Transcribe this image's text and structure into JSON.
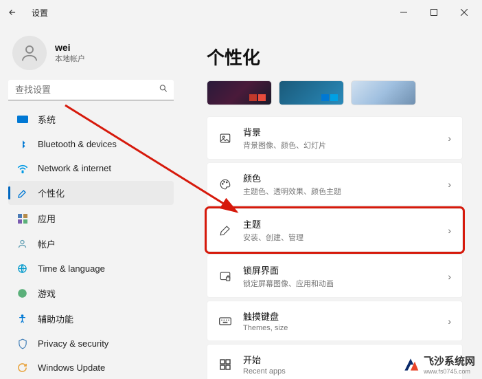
{
  "titlebar": {
    "title": "设置"
  },
  "user": {
    "name": "wei",
    "sub": "本地帐户"
  },
  "search": {
    "placeholder": "查找设置"
  },
  "nav": {
    "system": "系统",
    "bluetooth": "Bluetooth & devices",
    "network": "Network & internet",
    "personalization": "个性化",
    "apps": "应用",
    "accounts": "帐户",
    "time": "Time & language",
    "gaming": "游戏",
    "accessibility": "辅助功能",
    "privacy": "Privacy & security",
    "update": "Windows Update"
  },
  "page": {
    "title": "个性化"
  },
  "cards": {
    "background": {
      "title": "背景",
      "sub": "背景图像、颜色、幻灯片"
    },
    "colors": {
      "title": "颜色",
      "sub": "主题色、透明效果、颜色主题"
    },
    "themes": {
      "title": "主题",
      "sub": "安装、创建、管理"
    },
    "lockscreen": {
      "title": "锁屏界面",
      "sub": "锁定屏幕图像、应用和动画"
    },
    "touchkb": {
      "title": "触摸键盘",
      "sub": "Themes, size"
    },
    "start": {
      "title": "开始",
      "sub": "Recent apps"
    }
  },
  "watermark": {
    "brand": "飞沙系统网",
    "url": "www.fs0745.com"
  }
}
